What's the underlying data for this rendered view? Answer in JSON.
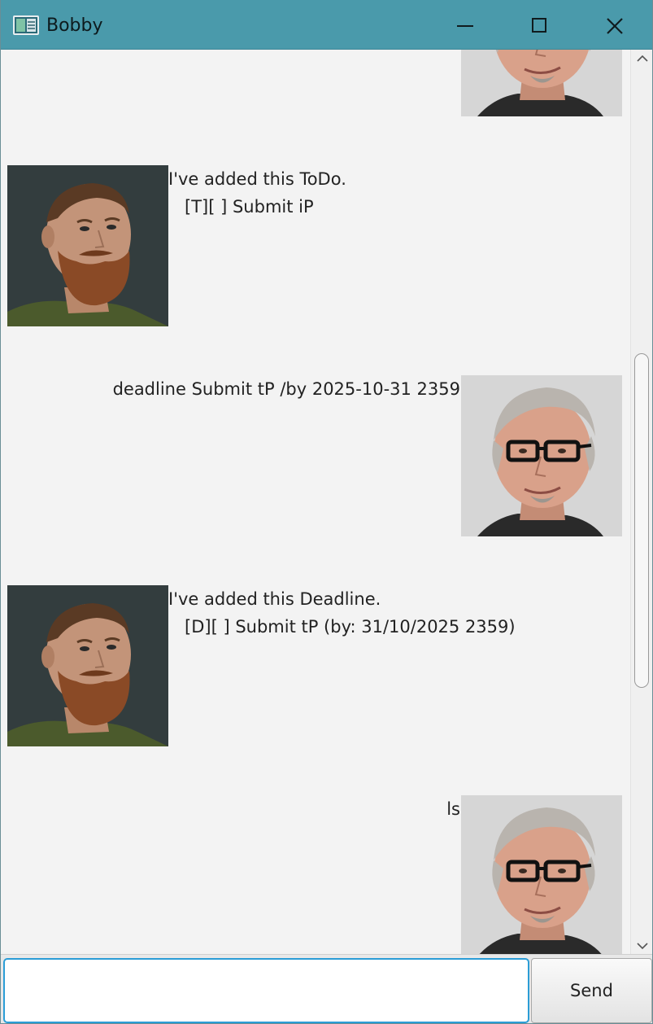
{
  "window": {
    "title": "Bobby"
  },
  "messages": [
    {
      "sender": "bot",
      "text": "I've added this ToDo.\n   [T][ ] Submit iP"
    },
    {
      "sender": "user",
      "text": "deadline Submit tP /by 2025-10-31 2359"
    },
    {
      "sender": "bot",
      "text": "I've added this Deadline.\n   [D][ ] Submit tP (by: 31/10/2025 2359)"
    },
    {
      "sender": "user",
      "text": "ls"
    }
  ],
  "input": {
    "value": "",
    "placeholder": ""
  },
  "send_button": {
    "label": "Send"
  },
  "colors": {
    "titlebar": "#4a9aab",
    "background": "#f3f3f3",
    "input_focus": "#2b9dd6"
  },
  "icons": {
    "app": "window-app-icon",
    "minimize": "minimize-icon",
    "maximize": "maximize-icon",
    "close": "close-icon"
  }
}
